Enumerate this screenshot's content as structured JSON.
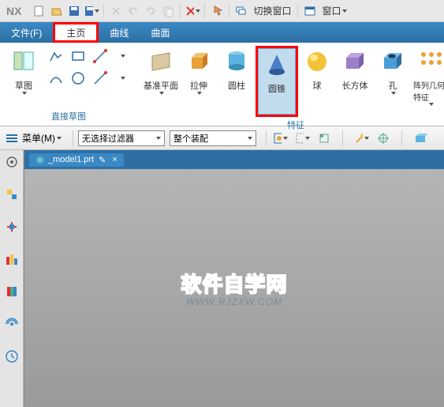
{
  "app": {
    "name": "NX"
  },
  "titlebar": {
    "switch_window": "切换窗口",
    "window_menu": "窗口"
  },
  "menubar": {
    "file": "文件(F)",
    "home": "主页",
    "curve": "曲线",
    "surface": "曲面"
  },
  "ribbon": {
    "sketch_group": "草图",
    "direct_sketch": "直接草图",
    "features_group": "特征",
    "datum_plane": "基准平面",
    "extrude": "拉伸",
    "cylinder": "圆柱",
    "cone": "圆锥",
    "sphere": "球",
    "cuboid": "长方体",
    "hole": "孔",
    "pattern_geom": "阵列几何特征"
  },
  "filterbar": {
    "menu_button": "菜单(M)",
    "selection_filter": "无选择过滤器",
    "assembly_scope": "整个装配"
  },
  "tab": {
    "model_name": "_model1.prt",
    "dirty_marker": "✎",
    "close": "×"
  },
  "watermark": {
    "line1": "软件自学网",
    "line2": "WWW.RJZXW.COM"
  },
  "colors": {
    "accent": "#2d6fa3",
    "highlight": "#ff0000"
  }
}
